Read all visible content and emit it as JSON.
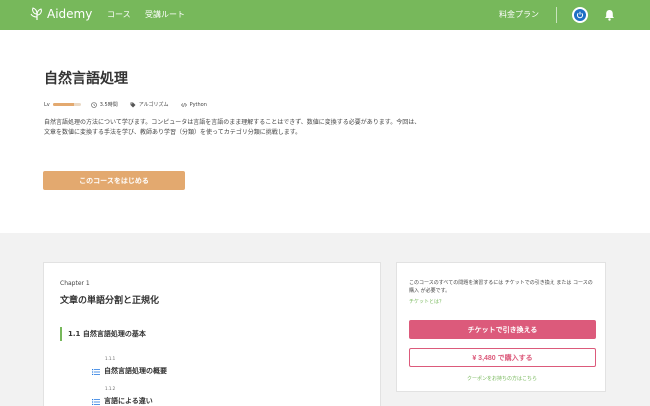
{
  "header": {
    "logo_text": "Aidemy",
    "nav_courses": "コース",
    "nav_route": "受講ルート",
    "nav_pricing": "料金プラン"
  },
  "course": {
    "title": "自然言語処理",
    "level_label": "Lv",
    "level_fraction": 0.75,
    "duration": "3.5時間",
    "tag_algorithm": "アルゴリズム",
    "tag_language": "Python",
    "description": "自然言語処理の方法について学びます。コンピュータは言語を言語のまま理解することはできず、数値に変換する必要があります。今回は、文章を数値に変換する手法を学び、教師あり学習（分類）を使ってカテゴリ分類に挑戦します。",
    "start_button": "このコースをはじめる"
  },
  "chapter": {
    "label": "Chapter 1",
    "title": "文章の単語分割と正規化",
    "section_title": "1.1 自然言語処理の基本",
    "lessons": [
      {
        "number": "1.1.1",
        "title": "自然言語処理の概要"
      },
      {
        "number": "1.1.2",
        "title": "言語による違い"
      }
    ]
  },
  "purchase": {
    "text": "このコースのすべての問題を演習するには チケットでの引き換え または コースの購入 が必要です。",
    "ticket_link": "チケットとは？",
    "ticket_button": "チケットで引き換える",
    "buy_button": "¥ 3,480 で購入する",
    "coupon_link": "クーポンをお持ちの方はこちら"
  },
  "colors": {
    "header_green": "#77b85b",
    "accent_orange": "#e3a96f",
    "accent_pink": "#dc5a7b",
    "power_blue": "#1e6fc5"
  }
}
